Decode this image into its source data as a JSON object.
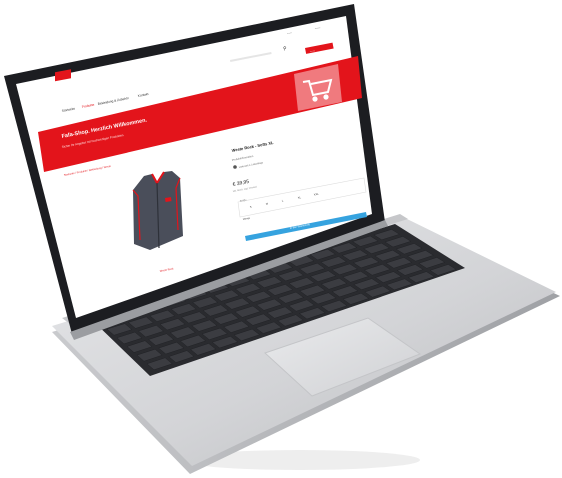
{
  "header": {
    "top_links": [
      "Anmelden",
      "Warenkorb"
    ],
    "cta_label": "Zum Shop"
  },
  "nav": {
    "items": [
      "Startseite",
      "Produkte",
      "Bekleidung & Zubehör",
      "Kontakt"
    ]
  },
  "banner": {
    "title": "Fafa-Shop. Herzlich Willkommen.",
    "subtitle": "Sicher Ihr Angebot mit hochwertigen Produkten."
  },
  "breadcrumb": "Startseite / Produkte / Bekleidung / Weste",
  "product": {
    "name": "Weste Rock - Softs XL",
    "info": "Produktinformation",
    "availability": "Lieferzeit 1-3 Werktage",
    "price": "€ 39,95",
    "tax": "inkl. MwSt. zzgl. Versand",
    "size_label": "Größe",
    "sizes": [
      "S",
      "M",
      "L",
      "XL",
      "XXL"
    ],
    "quantity_label": "Menge",
    "add_to_cart": "In den Warenkorb",
    "thumbnail_caption": "Weste Rock"
  },
  "colors": {
    "brand_red": "#e3141b",
    "button_blue": "#36a3df",
    "vest_body": "#4a4e5a",
    "laptop_silver": "#d6d7d9"
  }
}
